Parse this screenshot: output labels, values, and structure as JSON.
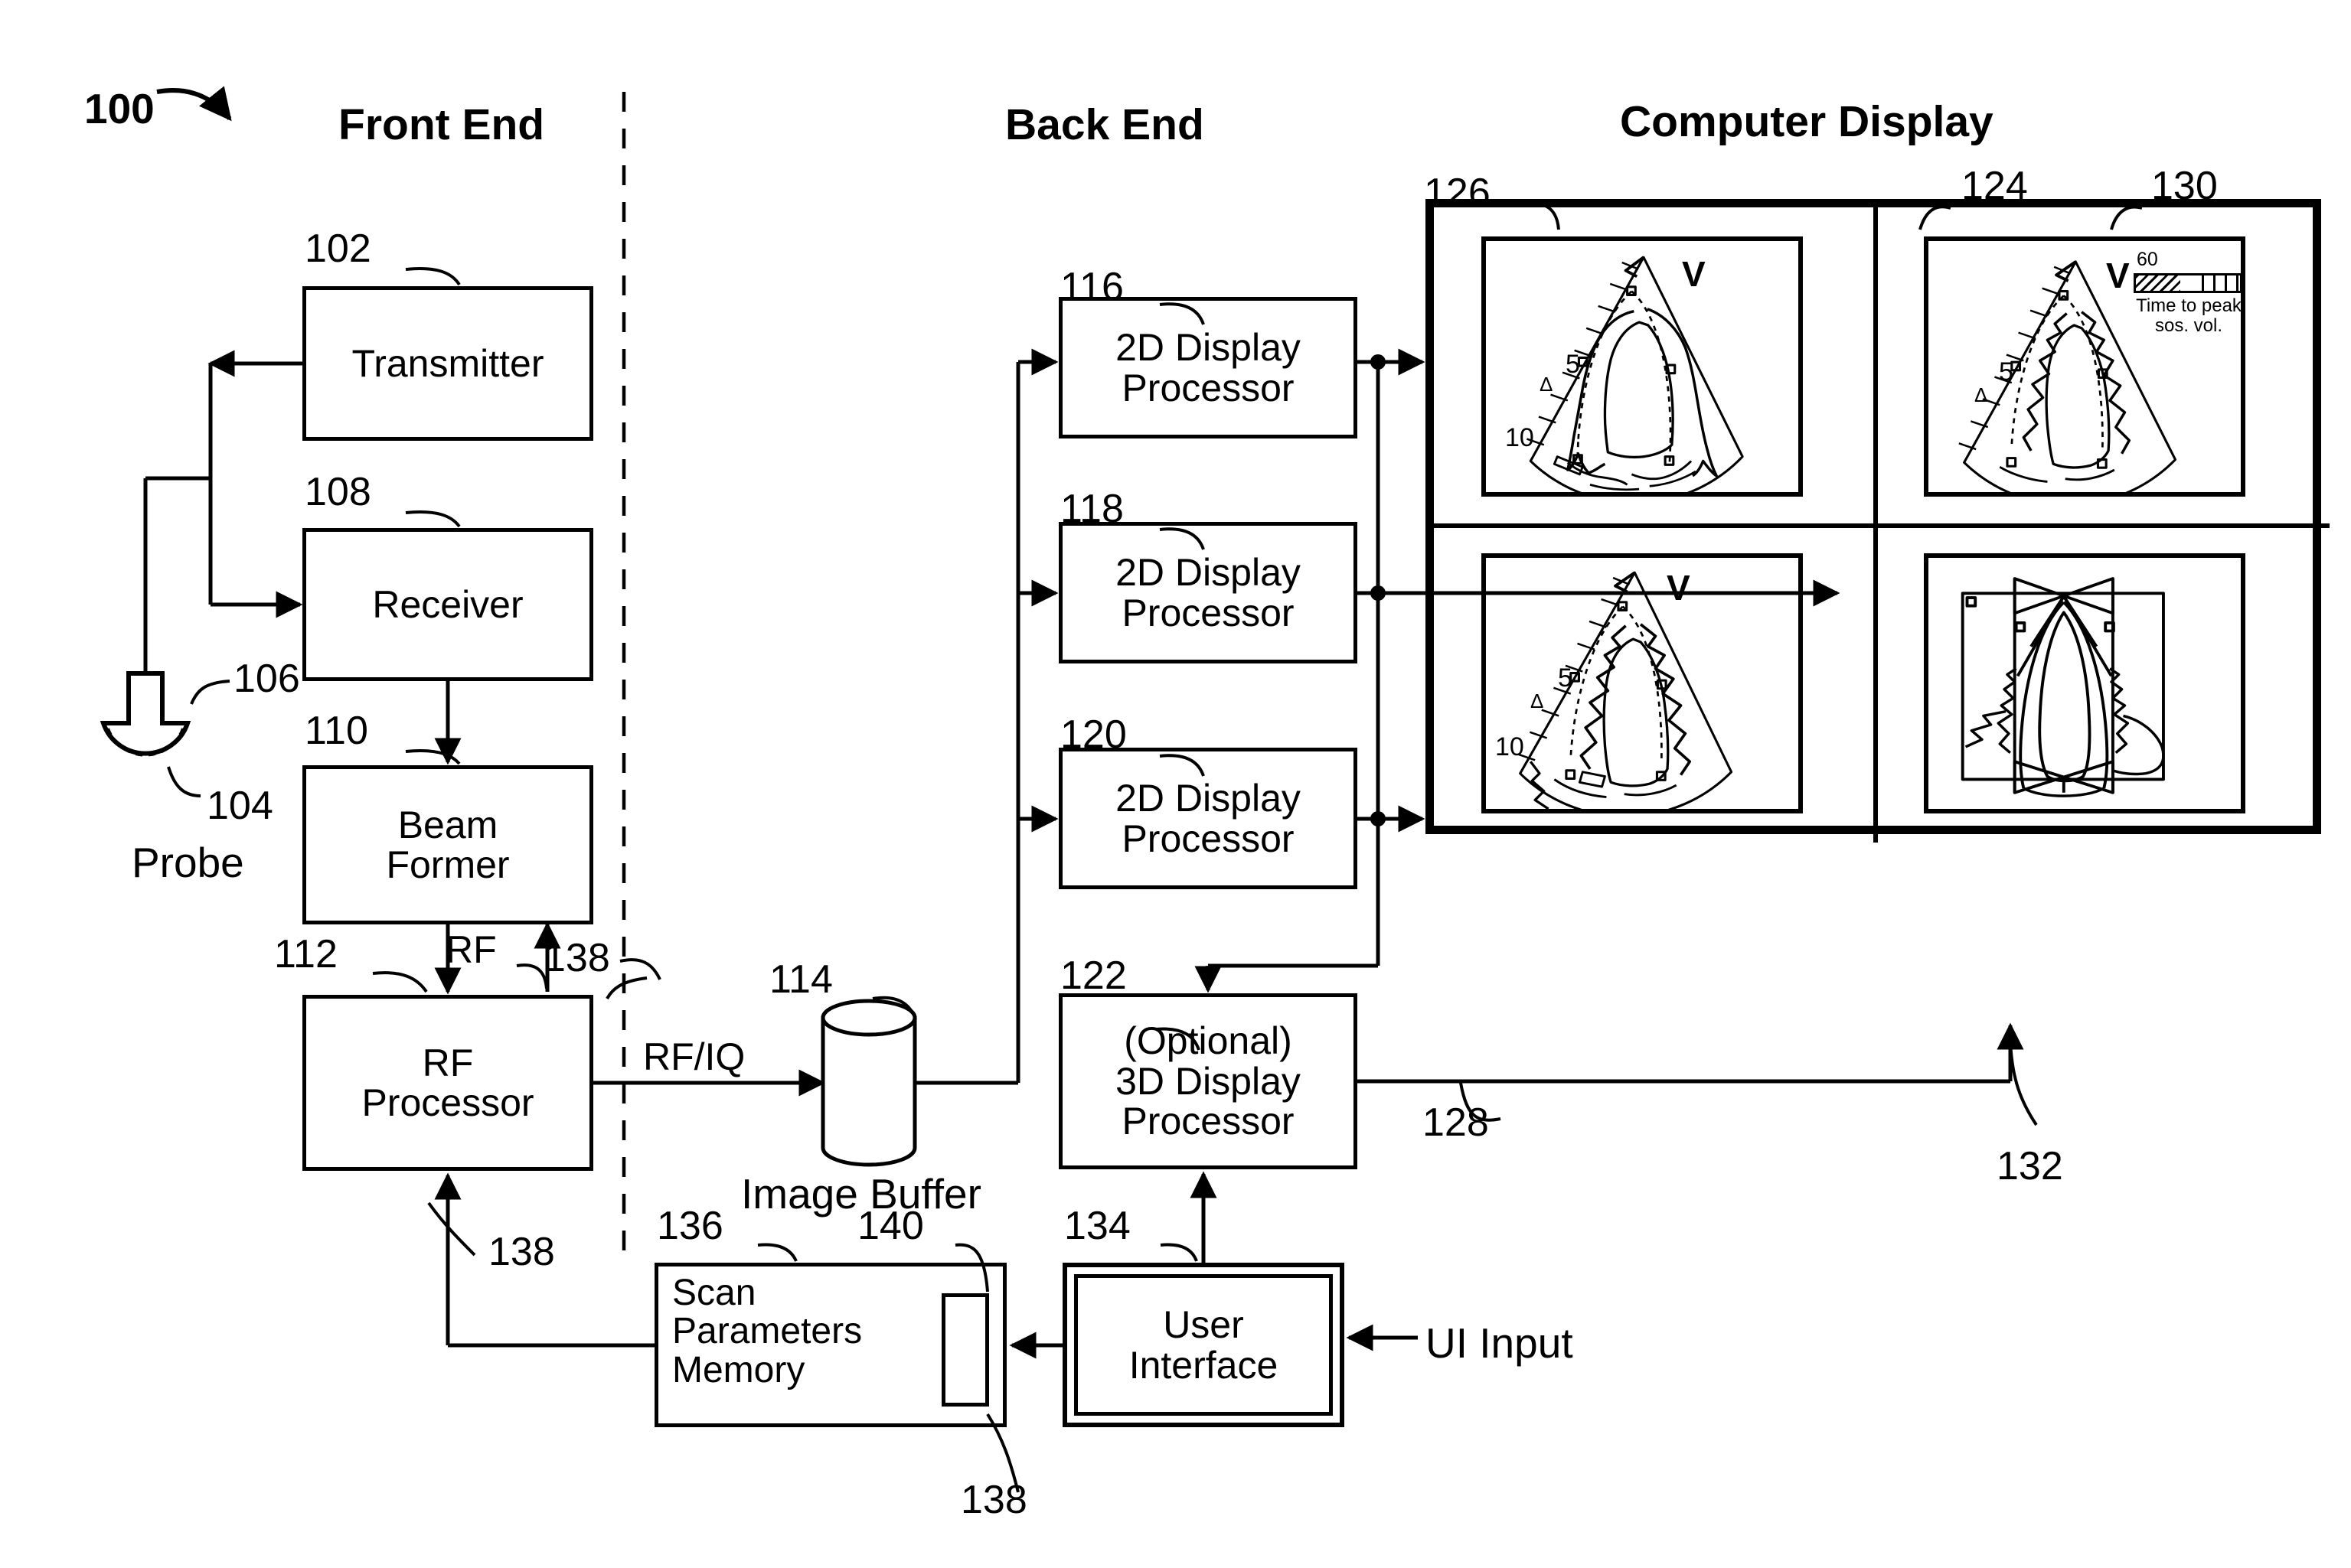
{
  "figure": {
    "figure_number": "100",
    "columns": [
      {
        "id": "front-end",
        "title": "Front End"
      },
      {
        "id": "back-end",
        "title": "Back End"
      },
      {
        "id": "computer-display",
        "title": "Computer Display"
      }
    ]
  },
  "blocks": {
    "transmitter": {
      "ref": "102",
      "label": "Transmitter"
    },
    "receiver": {
      "ref": "108",
      "label": "Receiver"
    },
    "beam_former": {
      "ref": "110",
      "label": "Beam\nFormer",
      "line1": "Beam",
      "line2": "Former"
    },
    "rf_processor": {
      "ref": "112",
      "label": "RF\nProcessor",
      "line1": "RF",
      "line2": "Processor"
    },
    "image_buffer": {
      "ref": "114",
      "label": "Image Buffer"
    },
    "disp_proc_1": {
      "ref": "116",
      "line1": "2D Display",
      "line2": "Processor"
    },
    "disp_proc_2": {
      "ref": "118",
      "line1": "2D Display",
      "line2": "Processor"
    },
    "disp_proc_3": {
      "ref": "120",
      "line1": "2D Display",
      "line2": "Processor"
    },
    "disp_proc_3d": {
      "ref": "122",
      "line1": "(Optional)",
      "line2": "3D Display",
      "line3": "Processor"
    },
    "scan_params_mem": {
      "ref": "136",
      "line1": "Scan",
      "line2": "Parameters",
      "line3": "Memory"
    },
    "scan_params_slot": {
      "ref": "140"
    },
    "user_interface": {
      "ref": "134",
      "line1": "User",
      "line2": "Interface"
    },
    "probe": {
      "ref": "104",
      "label": "Probe",
      "cable_ref": "106"
    }
  },
  "signals": {
    "rf": "RF",
    "rf_iq": "RF/IQ",
    "ui_input": "UI Input",
    "feedback_a": "138",
    "feedback_b": "138",
    "feedback_c": "138"
  },
  "display": {
    "monitor_ref": "130",
    "divider_ref": "124",
    "panel_top_left_ref": "126",
    "panel_bottom_left_ref": "128",
    "panel_bottom_right_ref": "132",
    "panels": [
      {
        "id": "tl",
        "v_label": "V",
        "depth_marks": [
          "5",
          "10"
        ],
        "marker": "Δ"
      },
      {
        "id": "tr",
        "v_label": "V",
        "depth_marks": [
          "5"
        ],
        "marker": "Δ",
        "colorbar_value": "60",
        "colorbar_caption_line1": "Time to peak",
        "colorbar_caption_line2": "sos. vol."
      },
      {
        "id": "bl",
        "v_label": "V",
        "depth_marks": [
          "5",
          "10"
        ],
        "marker": "Δ"
      },
      {
        "id": "br",
        "v_label": "",
        "depth_marks": [],
        "marker": ""
      }
    ]
  }
}
